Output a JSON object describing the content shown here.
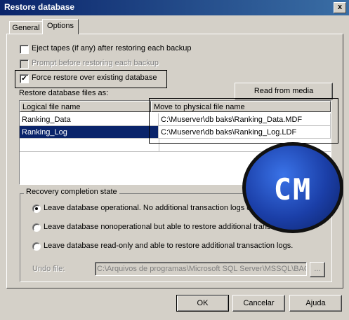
{
  "window": {
    "title": "Restore database",
    "close_glyph": "x"
  },
  "tabs": [
    {
      "label": "General"
    },
    {
      "label": "Options"
    }
  ],
  "options": {
    "eject_tapes": {
      "label": "Eject tapes (if any) after restoring each backup",
      "checked": false
    },
    "prompt_before": {
      "label": "Prompt before restoring each backup",
      "checked": false,
      "disabled": true
    },
    "force_restore": {
      "label": "Force restore over existing database",
      "checked": true,
      "check_glyph": "✔"
    }
  },
  "restore_files": {
    "label": "Restore database files as:",
    "read_from_media_button": "Read from media",
    "columns": [
      "Logical file name",
      "Move to physical file name"
    ],
    "rows": [
      {
        "logical": "Ranking_Data",
        "physical": "C:\\Muserver\\db baks\\Ranking_Data.MDF"
      },
      {
        "logical": "Ranking_Log",
        "physical": "C:\\Muserver\\db baks\\Ranking_Log.LDF",
        "selected": true
      }
    ]
  },
  "recovery": {
    "legend": "Recovery completion state",
    "options": [
      {
        "label": "Leave database operational. No additional transaction logs ca",
        "selected": true
      },
      {
        "label": "Leave database nonoperational but able to restore additional transa",
        "selected": false
      },
      {
        "label": "Leave database read-only and able to restore additional transaction logs.",
        "selected": false
      }
    ],
    "undo_file_label": "Undo file:",
    "undo_file_value": "C:\\Arquivos de programas\\Microsoft SQL Server\\MSSQL\\BAC",
    "browse_button": "..."
  },
  "footer": {
    "ok": "OK",
    "cancel": "Cancelar",
    "help": "Ajuda"
  },
  "watermark": {
    "text": "CM",
    "color": "#1b3fa8"
  }
}
